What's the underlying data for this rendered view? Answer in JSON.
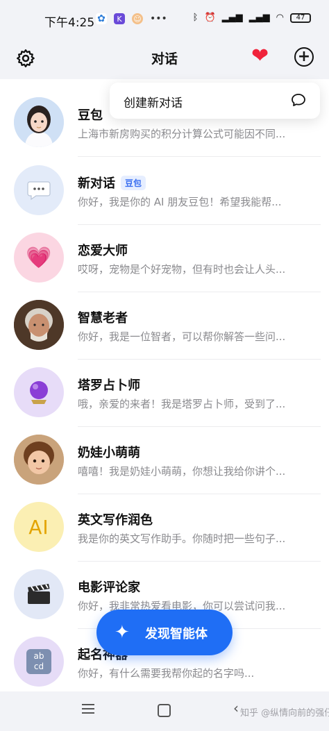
{
  "status_bar": {
    "time": "下午4:25",
    "battery": "47"
  },
  "header": {
    "title": "对话"
  },
  "popover": {
    "label": "创建新对话"
  },
  "conversations": [
    {
      "name": "豆包",
      "preview": "上海市新房购买的积分计算公式可能因不同...",
      "avatar": "girl-portrait"
    },
    {
      "name": "新对话",
      "tag": "豆包",
      "preview": "你好，我是你的 AI 朋友豆包！希望我能帮...",
      "avatar": "speech-bubble"
    },
    {
      "name": "恋爱大师",
      "preview": "哎呀，宠物是个好宠物，但有时也会让人头...",
      "avatar": "pink-heart"
    },
    {
      "name": "智慧老者",
      "preview": "你好，我是一位智者，可以帮你解答一些问...",
      "avatar": "old-man-portrait"
    },
    {
      "name": "塔罗占卜师",
      "preview": "哦，亲爱的来者！我是塔罗占卜师，受到了...",
      "avatar": "crystal-ball"
    },
    {
      "name": "奶娃小萌萌",
      "preview": "嘻嘻！我是奶娃小萌萌，你想让我给你讲个...",
      "avatar": "child-portrait"
    },
    {
      "name": "英文写作润色",
      "preview": "我是你的英文写作助手。你随时把一些句子...",
      "avatar": "AI",
      "avatar_text": "AI"
    },
    {
      "name": "电影评论家",
      "preview": "你好，我非常热爱看电影，你可以尝试问我...",
      "avatar": "clapper-board"
    },
    {
      "name": "起名神器",
      "preview": "你好，有什么需要我帮你起的名字吗...",
      "avatar": "abcd-keycap",
      "avatar_text": "ab cd"
    }
  ],
  "discover_button": {
    "label": "发现智能体"
  },
  "watermark": "知乎 @纵情向前的强仔",
  "colors": {
    "accent": "#1f6ef5",
    "heart": "#f0233b",
    "tag_bg": "#e6eeff",
    "tag_text": "#3a6ff0"
  }
}
